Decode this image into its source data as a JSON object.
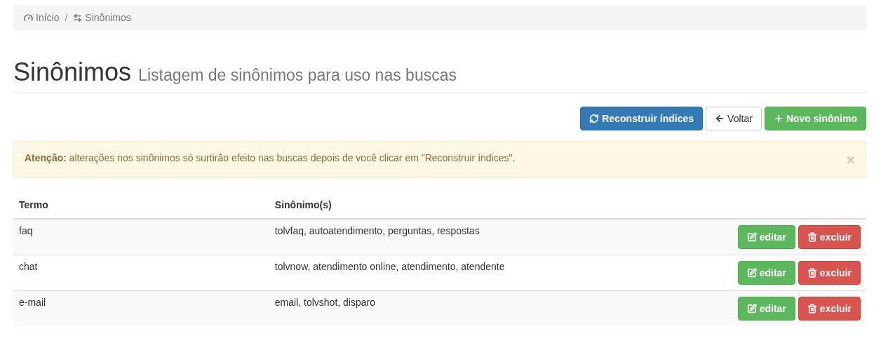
{
  "breadcrumb": {
    "items": [
      "Início",
      "Sinônimos"
    ],
    "separator": "/"
  },
  "page_header": {
    "title": "Sinônimos",
    "subtitle": "Listagem de sinônimos para uso nas buscas"
  },
  "toolbar": [
    {
      "label": "Reconstruir índices",
      "kind": "primary"
    },
    {
      "label": "Voltar",
      "kind": "default"
    },
    {
      "label": "Novo sinônimo",
      "kind": "success"
    }
  ],
  "alert": {
    "text": "**Atenção:** alterações nos sinônimos só surtirão efeito nas buscas depois de você clicar em \"Reconstruir índices\".",
    "close": "×"
  },
  "table": {
    "columns": [
      "Termo",
      "Sinônimo(s)"
    ],
    "rows": [
      {
        "term": "faq",
        "synonyms": "tolvfaq, autoatendimento, perguntas, respostas",
        "actions": [
          {
            "label": "editar",
            "kind": "success"
          },
          {
            "label": "excluir",
            "kind": "danger"
          }
        ]
      },
      {
        "term": "chat",
        "synonyms": "tolvnow, atendimento online, atendimento, atendente",
        "actions": [
          {
            "label": "editar",
            "kind": "success"
          },
          {
            "label": "excluir",
            "kind": "danger"
          }
        ]
      },
      {
        "term": "e-mail",
        "synonyms": "email, tolvshot, disparo",
        "actions": [
          {
            "label": "editar",
            "kind": "success"
          },
          {
            "label": "excluir",
            "kind": "danger"
          }
        ]
      }
    ]
  }
}
